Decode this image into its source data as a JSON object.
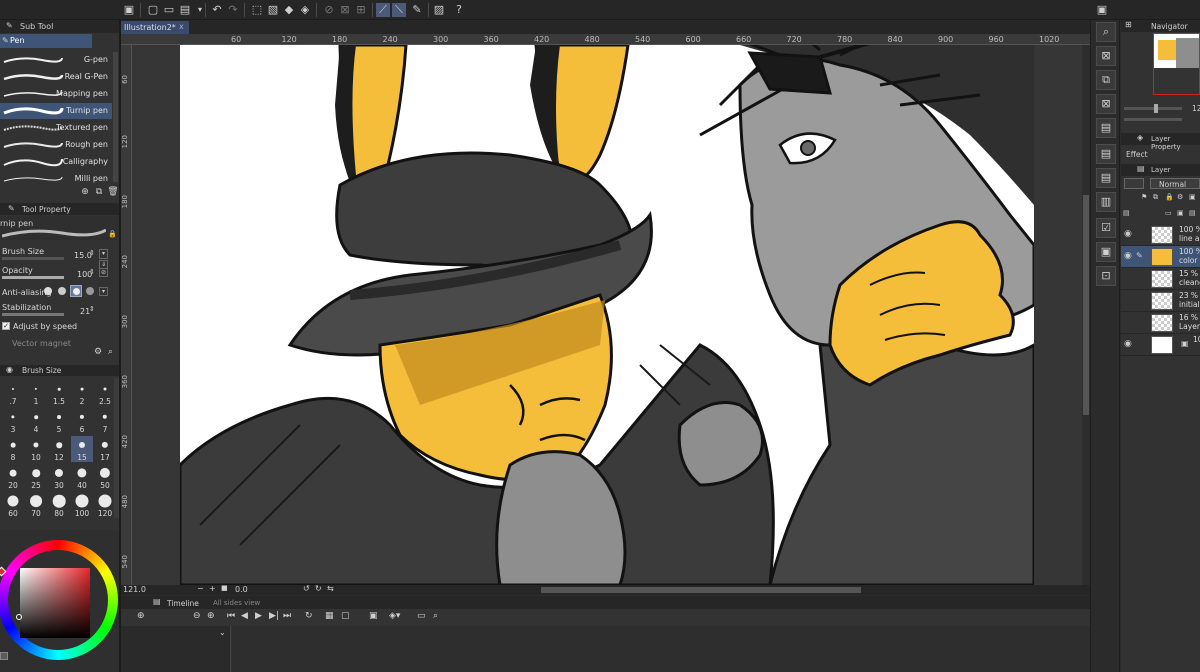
{
  "document_tab": {
    "title": "Illustration2*",
    "close": "x"
  },
  "subtool": {
    "tab": "Sub Tool",
    "group": "Pen",
    "items": [
      {
        "label": "G-pen"
      },
      {
        "label": "Real G-Pen"
      },
      {
        "label": "Mapping pen"
      },
      {
        "label": "Turnip pen",
        "selected": true
      },
      {
        "label": "Textured pen"
      },
      {
        "label": "Rough pen"
      },
      {
        "label": "Calligraphy"
      },
      {
        "label": "Milli pen"
      }
    ]
  },
  "tool_property": {
    "tab": "Tool Property",
    "tool_name": "rnip pen",
    "brush_size_label": "Brush Size",
    "brush_size_value": "15.0",
    "opacity_label": "Opacity",
    "opacity_value": "100",
    "antialias_label": "Anti-aliasing",
    "stabilization_label": "Stabilization",
    "stabilization_value": "21",
    "adjust_label": "Adjust by speed",
    "vector_magnet_label": "Vector magnet"
  },
  "brush_size_panel": {
    "tab": "Brush Size",
    "sizes": [
      ".7",
      "1",
      "1.5",
      "2",
      "2.5",
      "3",
      "4",
      "5",
      "6",
      "7",
      "8",
      "10",
      "12",
      "15",
      "17",
      "20",
      "25",
      "30",
      "40",
      "50",
      "60",
      "70",
      "80",
      "100",
      "120"
    ],
    "selected": "15"
  },
  "ruler_top": [
    "60",
    "120",
    "180",
    "240",
    "300",
    "360",
    "420",
    "480",
    "540",
    "600",
    "660",
    "720",
    "780",
    "840",
    "900",
    "960",
    "1020"
  ],
  "ruler_left": [
    "60",
    "120",
    "180",
    "240",
    "300",
    "360",
    "420",
    "480",
    "540"
  ],
  "status_bar": {
    "zoom": "121.0",
    "angle": "0.0"
  },
  "timeline": {
    "tab": "Timeline",
    "second_tab": "All sides view"
  },
  "navigator": {
    "tab": "Navigator",
    "zoom_value": "12"
  },
  "layer_property": {
    "tab": "Layer Property",
    "effect_label": "Effect"
  },
  "layer_panel": {
    "tab": "Layer",
    "blend_mode": "Normal",
    "layers": [
      {
        "pct": "100 %",
        "name": "line art"
      },
      {
        "pct": "100 %",
        "name": "color",
        "selected": true
      },
      {
        "pct": "15 % N",
        "name": "cleane"
      },
      {
        "pct": "23 % N",
        "name": "initial s"
      },
      {
        "pct": "16 % N",
        "name": "Layer"
      },
      {
        "pct": "100",
        "name": ""
      }
    ]
  },
  "colors": {
    "accent": "#3f5578",
    "canvas_bg": "#ffffff",
    "skin": "#f5be3a",
    "ink": "#121212"
  }
}
